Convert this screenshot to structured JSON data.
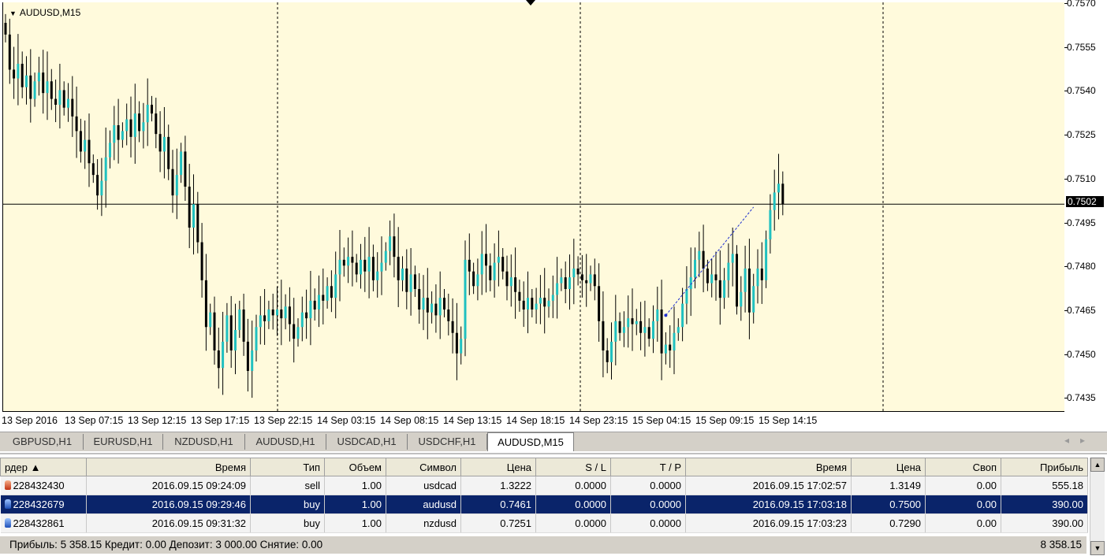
{
  "chart": {
    "symbol": "AUDUSD,M15",
    "current_price_label": "0.7502",
    "y_ticks": [
      "0.7570",
      "0.7555",
      "0.7540",
      "0.7525",
      "0.7510",
      "0.7495",
      "0.7480",
      "0.7465",
      "0.7450",
      "0.7435"
    ],
    "x_ticks": [
      "13 Sep 2016",
      "13 Sep 07:15",
      "13 Sep 12:15",
      "13 Sep 17:15",
      "13 Sep 22:15",
      "14 Sep 03:15",
      "14 Sep 08:15",
      "14 Sep 13:15",
      "14 Sep 18:15",
      "14 Sep 23:15",
      "15 Sep 04:15",
      "15 Sep 09:15",
      "15 Sep 14:15"
    ],
    "colors": {
      "background": "#fffadc",
      "bull": "#20c0c0",
      "bear": "#000000",
      "trendline": "#2030d0"
    }
  },
  "chart_data": {
    "type": "candlestick",
    "ylim": [
      0.7431,
      0.7571
    ],
    "current_price": 0.7502,
    "closes": [
      0.756,
      0.7548,
      0.7545,
      0.755,
      0.7542,
      0.7546,
      0.7538,
      0.7544,
      0.7547,
      0.754,
      0.7544,
      0.7538,
      0.7536,
      0.7541,
      0.7535,
      0.7538,
      0.7532,
      0.7527,
      0.752,
      0.7524,
      0.7516,
      0.7512,
      0.7505,
      0.751,
      0.7518,
      0.7523,
      0.7529,
      0.7524,
      0.7527,
      0.7531,
      0.7525,
      0.7533,
      0.7527,
      0.753,
      0.7536,
      0.7533,
      0.7526,
      0.752,
      0.7525,
      0.7514,
      0.7505,
      0.7512,
      0.752,
      0.7508,
      0.7494,
      0.7502,
      0.7489,
      0.7476,
      0.746,
      0.7465,
      0.7452,
      0.7446,
      0.7455,
      0.7464,
      0.7452,
      0.7459,
      0.7466,
      0.7455,
      0.7445,
      0.7452,
      0.746,
      0.7464,
      0.7462,
      0.7466,
      0.7464,
      0.7466,
      0.7463,
      0.7467,
      0.7461,
      0.7456,
      0.746,
      0.7465,
      0.7463,
      0.7469,
      0.7466,
      0.7471,
      0.7469,
      0.7474,
      0.747,
      0.7478,
      0.7483,
      0.7481,
      0.7484,
      0.7482,
      0.7478,
      0.7483,
      0.7479,
      0.7484,
      0.7476,
      0.7479,
      0.7482,
      0.7486,
      0.7491,
      0.7484,
      0.7476,
      0.748,
      0.7472,
      0.7478,
      0.7473,
      0.7466,
      0.747,
      0.7465,
      0.7468,
      0.7464,
      0.747,
      0.7466,
      0.7462,
      0.7458,
      0.7451,
      0.7456,
      0.7483,
      0.7479,
      0.7474,
      0.7478,
      0.7485,
      0.7481,
      0.7476,
      0.7482,
      0.7484,
      0.7479,
      0.7474,
      0.7477,
      0.7472,
      0.7469,
      0.7466,
      0.747,
      0.7466,
      0.7468,
      0.747,
      0.7467,
      0.7469,
      0.7471,
      0.7475,
      0.7477,
      0.7473,
      0.7477,
      0.748,
      0.7478,
      0.7476,
      0.7475,
      0.7478,
      0.7474,
      0.7462,
      0.7452,
      0.7448,
      0.7455,
      0.7462,
      0.7458,
      0.746,
      0.7463,
      0.7461,
      0.7462,
      0.7458,
      0.746,
      0.7456,
      0.7462,
      0.7466,
      0.7451,
      0.7454,
      0.7452,
      0.7458,
      0.746,
      0.7468,
      0.7473,
      0.7477,
      0.7483,
      0.7486,
      0.748,
      0.7475,
      0.7478,
      0.7476,
      0.747,
      0.7476,
      0.7482,
      0.7485,
      0.7467,
      0.7472,
      0.748,
      0.7465,
      0.7474,
      0.748,
      0.7476,
      0.749,
      0.75,
      0.7506,
      0.7509,
      0.7502
    ],
    "trendline": {
      "from_index": 158,
      "from_value": 0.7464,
      "to_index": 179,
      "to_value": 0.7501
    }
  },
  "tabs": [
    "GBPUSD,H1",
    "EURUSD,H1",
    "NZDUSD,H1",
    "AUDUSD,H1",
    "USDCAD,H1",
    "USDCHF,H1",
    "AUDUSD,M15"
  ],
  "active_tab": 6,
  "table": {
    "headers": [
      "рдер ▲",
      "Время",
      "Тип",
      "Объем",
      "Символ",
      "Цена",
      "S / L",
      "T / P",
      "Время",
      "Цена",
      "Своп",
      "Прибыль"
    ],
    "rows": [
      {
        "order": "228432430",
        "open_time": "2016.09.15 09:24:09",
        "type": "sell",
        "volume": "1.00",
        "symbol": "usdcad",
        "open_price": "1.3222",
        "sl": "0.0000",
        "tp": "0.0000",
        "close_time": "2016.09.15 17:02:57",
        "price": "1.3149",
        "swap": "0.00",
        "profit": "555.18",
        "icon": "red"
      },
      {
        "order": "228432679",
        "open_time": "2016.09.15 09:29:46",
        "type": "buy",
        "volume": "1.00",
        "symbol": "audusd",
        "open_price": "0.7461",
        "sl": "0.0000",
        "tp": "0.0000",
        "close_time": "2016.09.15 17:03:18",
        "price": "0.7500",
        "swap": "0.00",
        "profit": "390.00",
        "icon": "blue"
      },
      {
        "order": "228432861",
        "open_time": "2016.09.15 09:31:32",
        "type": "buy",
        "volume": "1.00",
        "symbol": "nzdusd",
        "open_price": "0.7251",
        "sl": "0.0000",
        "tp": "0.0000",
        "close_time": "2016.09.15 17:03:23",
        "price": "0.7290",
        "swap": "0.00",
        "profit": "390.00",
        "icon": "blue"
      }
    ],
    "selected_row": 1
  },
  "summary": {
    "text": "Прибыль: 5 358.15  Кредит: 0.00  Депозит: 3 000.00  Снятие: 0.00",
    "total": "8 358.15"
  }
}
